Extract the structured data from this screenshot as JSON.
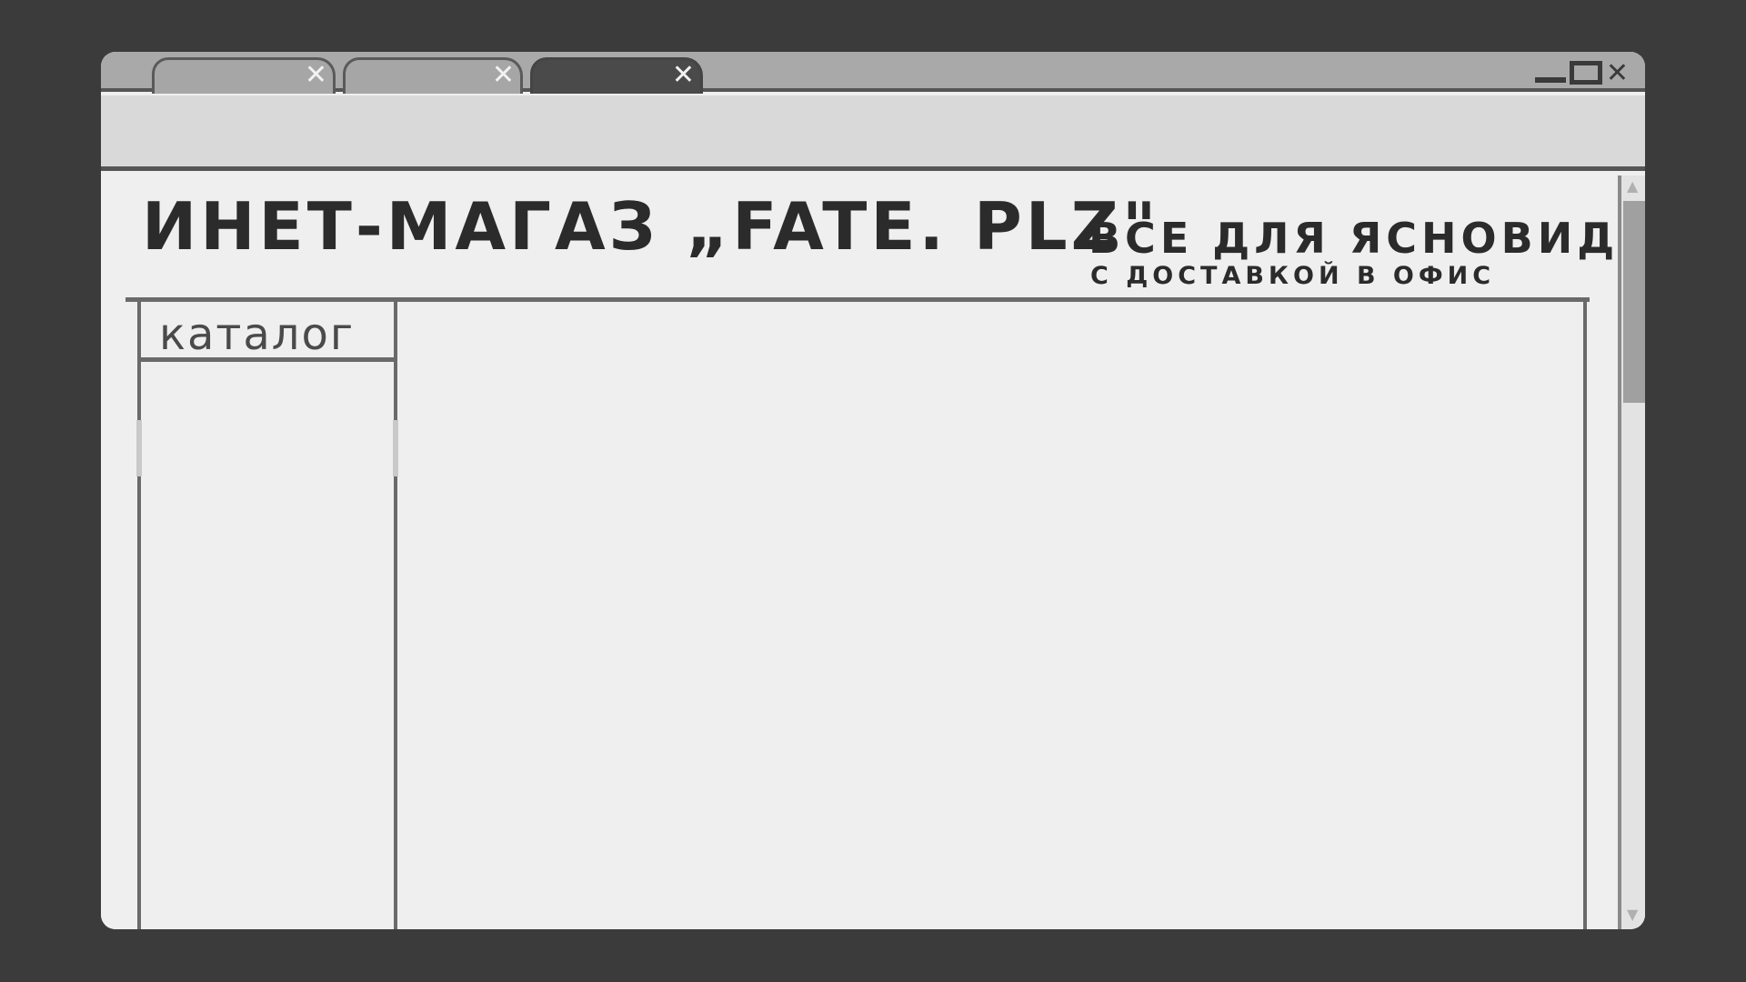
{
  "browser": {
    "tabs": [
      {
        "label": "",
        "close_glyph": "✕",
        "active": false
      },
      {
        "label": "",
        "close_glyph": "✕",
        "active": false
      },
      {
        "label": "",
        "close_glyph": "✕",
        "active": true
      }
    ],
    "window_controls": {
      "minimize": "",
      "maximize": "",
      "close": "✕"
    }
  },
  "header": {
    "shop_title": "ИНЕТ-МАГАЗ „FATE. PLZ\"",
    "tagline": "ВСЕ ДЛЯ ЯСНОВИДЦА",
    "tagline_sub": "С ДОСТАВКОЙ В ОФИС"
  },
  "sidebar": {
    "catalog_label": "каталог"
  },
  "scrollbar": {
    "up_icon": "scroll-up-arrow-icon",
    "down_icon": "scroll-down-arrow-icon"
  }
}
